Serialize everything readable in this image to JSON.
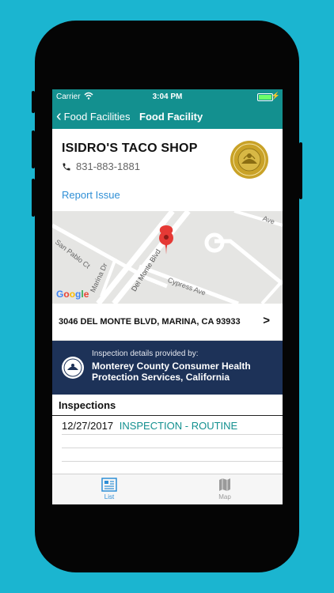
{
  "status_bar": {
    "carrier": "Carrier",
    "time": "3:04 PM"
  },
  "nav": {
    "back_label": "Food Facilities",
    "title": "Food Facility"
  },
  "facility": {
    "name": "ISIDRO'S TACO SHOP",
    "phone": "831-883-1881",
    "report_label": "Report Issue"
  },
  "map": {
    "streets": {
      "san_pablo": "San Pablo Ct",
      "marina": "Marina Dr",
      "del_monte": "Del Monte Blvd",
      "cypress": "Cypress Ave",
      "ave_top": "Ave"
    },
    "google_logo": [
      "G",
      "o",
      "o",
      "g",
      "l",
      "e"
    ],
    "google_colors": [
      "#4285F4",
      "#EA4335",
      "#FBBC05",
      "#4285F4",
      "#34A853",
      "#EA4335"
    ],
    "pin_color": "#e53935"
  },
  "address": {
    "text": "3046 DEL MONTE BLVD, MARINA, CA 93933",
    "arrow": ">"
  },
  "provider": {
    "label": "Inspection details provided by:",
    "name": "Monterey County Consumer Health Protection Services, California"
  },
  "inspections": {
    "header": "Inspections",
    "items": [
      {
        "date": "12/27/2017",
        "type": "INSPECTION - ROUTINE"
      }
    ]
  },
  "tabs": [
    {
      "label": "List"
    },
    {
      "label": "Map"
    }
  ],
  "colors": {
    "teal": "#13908f",
    "navy": "#1d3258",
    "link_blue": "#2f8fd6",
    "background": "#1bb5d0"
  }
}
